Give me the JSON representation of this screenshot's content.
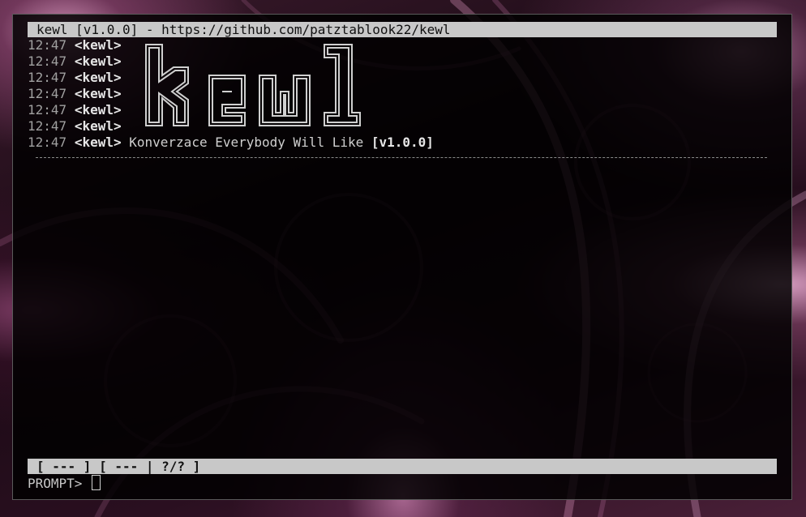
{
  "window": {
    "title": "kewl [v1.0.0] - https://github.com/patztablook22/kewl"
  },
  "log": [
    {
      "time": "12:47",
      "nick": "<kewl>",
      "message": ""
    },
    {
      "time": "12:47",
      "nick": "<kewl>",
      "message": ""
    },
    {
      "time": "12:47",
      "nick": "<kewl>",
      "message": ""
    },
    {
      "time": "12:47",
      "nick": "<kewl>",
      "message": ""
    },
    {
      "time": "12:47",
      "nick": "<kewl>",
      "message": ""
    },
    {
      "time": "12:47",
      "nick": "<kewl>",
      "message": ""
    },
    {
      "time": "12:47",
      "nick": "<kewl>",
      "message": "Konverzace Everybody Will Like ",
      "version": "[v1.0.0]"
    }
  ],
  "banner": {
    "text": "kewl",
    "style": "ascii-art-outline"
  },
  "status_bar": {
    "left_segment": "[ --- ]",
    "right_segment": "[ --- | ?/? ]"
  },
  "prompt": {
    "label": "PROMPT> ",
    "value": ""
  },
  "colors": {
    "terminal_bg": "#000000",
    "bar_bg": "#c8c8c8",
    "text": "#c6c6c6",
    "wallpaper_accent": "#b07098"
  }
}
